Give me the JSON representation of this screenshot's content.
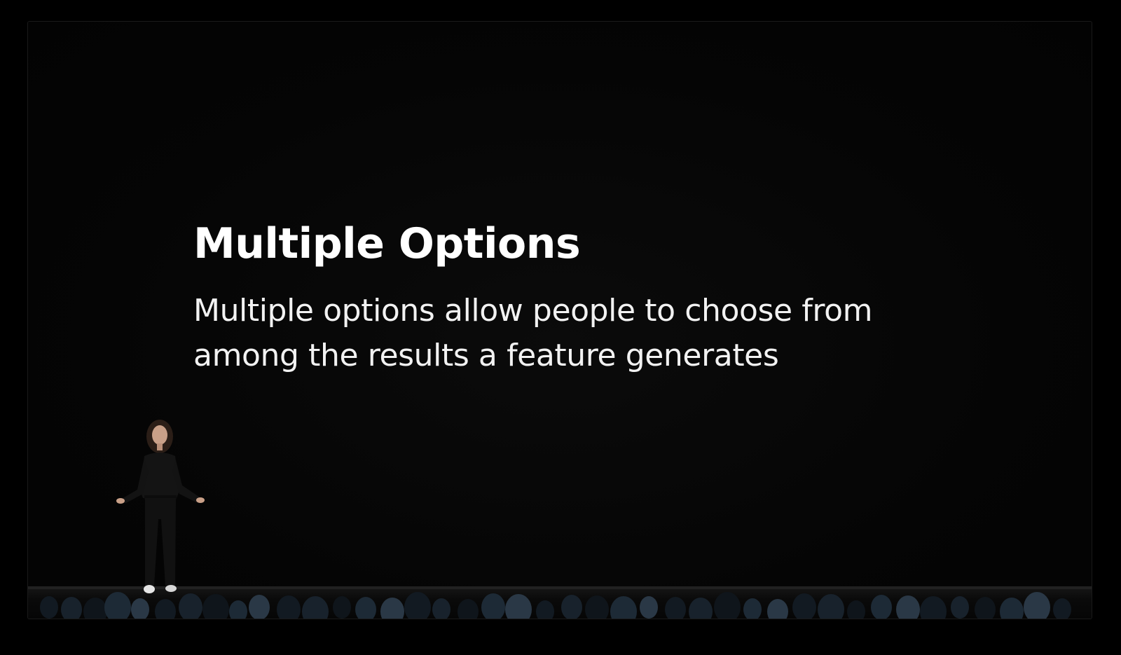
{
  "slide": {
    "title": "Multiple Options",
    "body": "Multiple options allow people to choose from among the results a feature generates"
  },
  "colors": {
    "background": "#000000",
    "screen": "#050505",
    "title_text": "#ffffff",
    "body_text": "#f2f2f2"
  }
}
